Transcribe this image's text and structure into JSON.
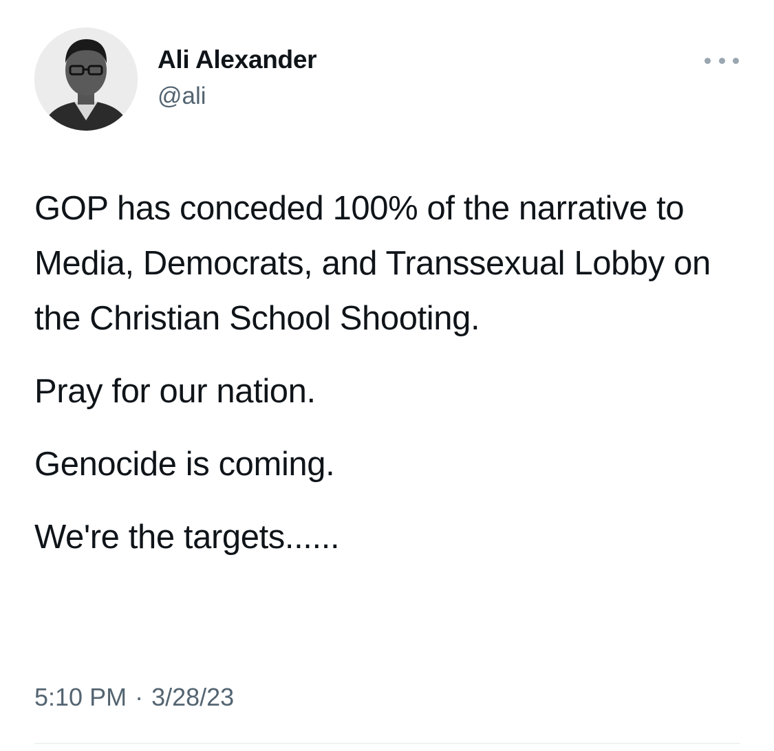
{
  "author": {
    "name": "Ali Alexander",
    "handle": "@ali"
  },
  "tweet": {
    "paragraphs": [
      "GOP has conceded 100% of the narrative to Media, Democrats, and Transsexual Lobby on the Christian School Shooting.",
      "Pray for our nation.",
      "Genocide is coming.",
      "We're the targets......"
    ]
  },
  "meta": {
    "time": "5:10 PM",
    "separator": "·",
    "date": "3/28/23"
  },
  "icons": {
    "more": "more-horizontal-icon",
    "avatar": "profile-photo"
  },
  "colors": {
    "text": "#0f1419",
    "secondary": "#536471",
    "more_dots": "#9aa6b0",
    "divider": "#eff3f4"
  }
}
